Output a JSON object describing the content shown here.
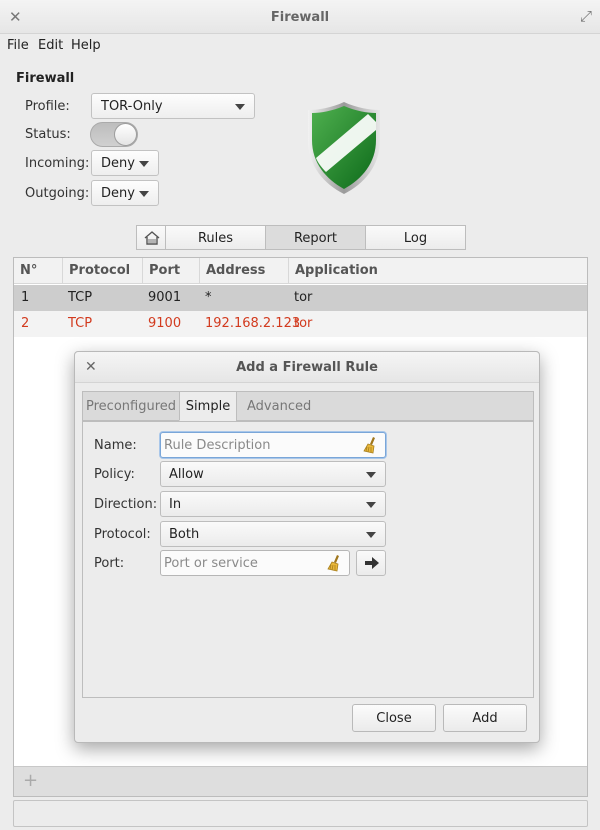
{
  "window": {
    "title": "Firewall"
  },
  "menu": {
    "file": "File",
    "edit": "Edit",
    "help": "Help"
  },
  "firewall": {
    "section_title": "Firewall",
    "profile_label": "Profile:",
    "profile_value": "TOR-Only",
    "status_label": "Status:",
    "status_on": true,
    "incoming_label": "Incoming:",
    "incoming_value": "Deny",
    "outgoing_label": "Outgoing:",
    "outgoing_value": "Deny"
  },
  "tabs": {
    "rules": "Rules",
    "report": "Report",
    "log": "Log",
    "active": "Report"
  },
  "report": {
    "columns": [
      "N°",
      "Protocol",
      "Port",
      "Address",
      "Application"
    ],
    "rows": [
      {
        "n": "1",
        "protocol": "TCP",
        "port": "9001",
        "address": "*",
        "application": "tor"
      },
      {
        "n": "2",
        "protocol": "TCP",
        "port": "9100",
        "address": "192.168.2.123",
        "application": "tor"
      }
    ]
  },
  "dialog": {
    "title": "Add a Firewall Rule",
    "tabs": {
      "preconfigured": "Preconfigured",
      "simple": "Simple",
      "advanced": "Advanced",
      "active": "Simple"
    },
    "name_label": "Name:",
    "name_placeholder": "Rule Description",
    "policy_label": "Policy:",
    "policy_value": "Allow",
    "direction_label": "Direction:",
    "direction_value": "In",
    "protocol_label": "Protocol:",
    "protocol_value": "Both",
    "port_label": "Port:",
    "port_placeholder": "Port or service",
    "close_button": "Close",
    "add_button": "Add"
  },
  "colors": {
    "highlight_row": "#d23a1e",
    "shield_green": "#1f8a2e"
  }
}
